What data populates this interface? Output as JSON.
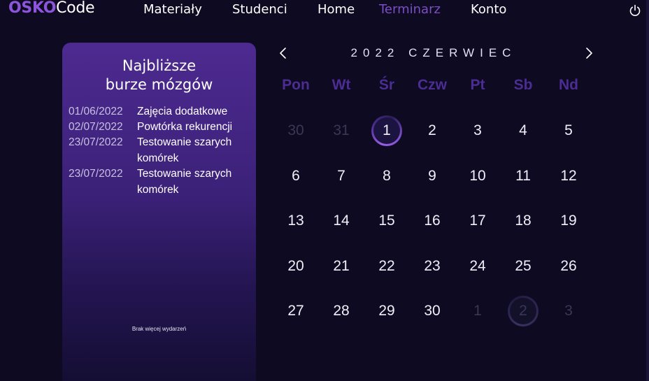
{
  "header": {
    "logo_part1": "OSKO",
    "logo_part2": "Code",
    "nav": [
      "Materiały",
      "Studenci",
      "Home",
      "Terminarz",
      "Konto"
    ],
    "active_nav": "Terminarz",
    "power_icon": "power-icon"
  },
  "events_panel": {
    "title_line1": "Najbliższe",
    "title_line2": "burze mózgów",
    "events": [
      {
        "date": "01/06/2022",
        "name": "Zajęcia dodatkowe"
      },
      {
        "date": "02/07/2022",
        "name": "Powtórka rekurencji"
      },
      {
        "date": "23/07/2022",
        "name": "Testowanie szarych komórek"
      },
      {
        "date": "23/07/2022",
        "name": "Testowanie szarych komórek"
      }
    ],
    "no_more_text": "Brak więcej wydarzeń"
  },
  "calendar": {
    "month_title": "2022 CZERWIEC",
    "prev_icon": "chevron-left-icon",
    "next_icon": "chevron-right-icon",
    "weekdays": [
      "Pon",
      "Wt",
      "Śr",
      "Czw",
      "Pt",
      "Sb",
      "Nd"
    ],
    "weeks": [
      [
        "30",
        "31",
        "1",
        "2",
        "3",
        "4",
        "5"
      ],
      [
        "6",
        "7",
        "8",
        "9",
        "10",
        "11",
        "12"
      ],
      [
        "13",
        "14",
        "15",
        "16",
        "17",
        "18",
        "19"
      ],
      [
        "20",
        "21",
        "22",
        "23",
        "24",
        "25",
        "26"
      ],
      [
        "27",
        "28",
        "29",
        "30",
        "1",
        "2",
        "3"
      ]
    ],
    "today": "1",
    "highlighted_other_month": "2"
  },
  "colors": {
    "background": "#0d0a21",
    "accent": "#7b4ec6",
    "weekday": "#4b2d93",
    "panel_top": "#4d2a90"
  }
}
